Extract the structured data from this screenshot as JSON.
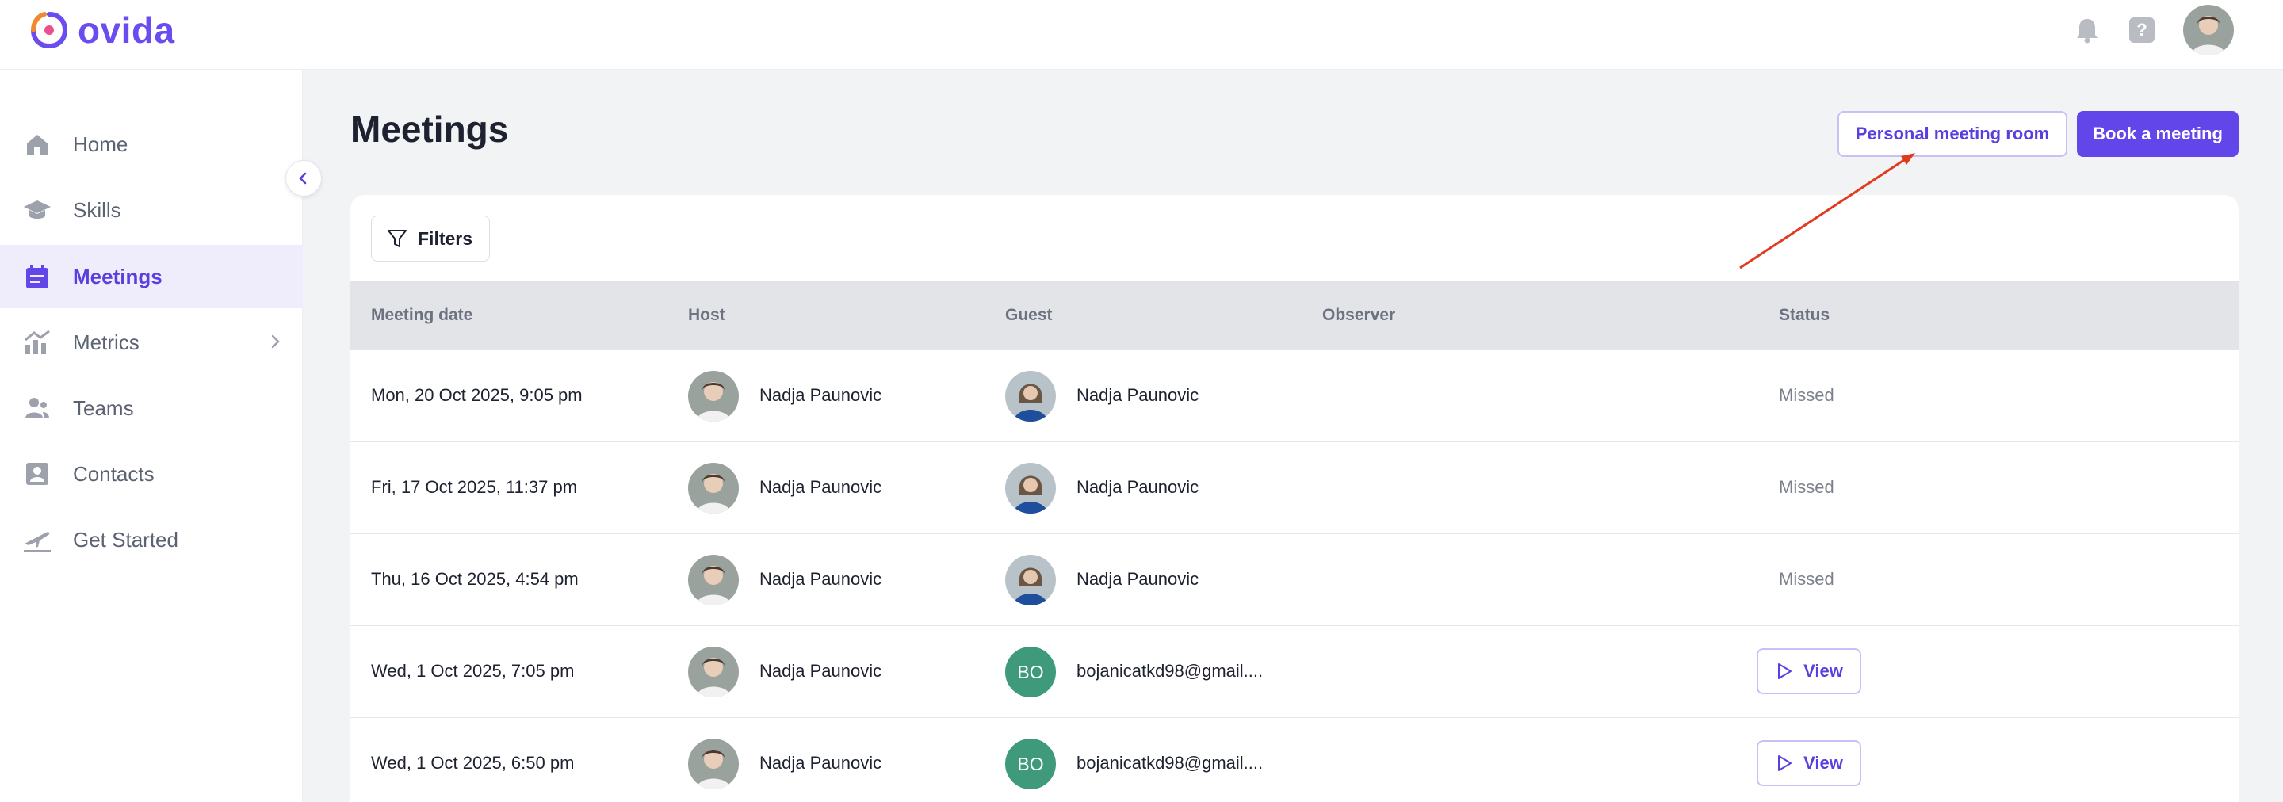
{
  "app": {
    "name": "ovida"
  },
  "colors": {
    "brand": "#6246ea",
    "active_bg": "#efedfb",
    "initials_bg": "#3e9a7a",
    "annotation_arrow": "#e23a1f"
  },
  "topbar": {
    "icons": [
      "bell-icon",
      "help-icon",
      "user-avatar"
    ],
    "help_label": "?"
  },
  "sidebar": {
    "items": [
      {
        "label": "Home",
        "icon": "home-icon",
        "active": false
      },
      {
        "label": "Skills",
        "icon": "graduation-cap-icon",
        "active": false
      },
      {
        "label": "Meetings",
        "icon": "calendar-icon",
        "active": true
      },
      {
        "label": "Metrics",
        "icon": "chart-icon",
        "active": false,
        "has_submenu": true
      },
      {
        "label": "Teams",
        "icon": "people-icon",
        "active": false
      },
      {
        "label": "Contacts",
        "icon": "contact-card-icon",
        "active": false
      },
      {
        "label": "Get Started",
        "icon": "plane-icon",
        "active": false
      }
    ]
  },
  "main": {
    "title": "Meetings",
    "personal_room_label": "Personal meeting room",
    "book_label": "Book a meeting",
    "filters_label": "Filters",
    "columns": [
      "Meeting date",
      "Host",
      "Guest",
      "Observer",
      "Status"
    ],
    "rows": [
      {
        "date": "Mon, 20 Oct 2025, 9:05 pm",
        "host": "Nadja Paunovic",
        "guest": "Nadja Paunovic",
        "guest_initials": "",
        "observer": "",
        "status": "Missed"
      },
      {
        "date": "Fri, 17 Oct 2025, 11:37 pm",
        "host": "Nadja Paunovic",
        "guest": "Nadja Paunovic",
        "guest_initials": "",
        "observer": "",
        "status": "Missed"
      },
      {
        "date": "Thu, 16 Oct 2025, 4:54 pm",
        "host": "Nadja Paunovic",
        "guest": "Nadja Paunovic",
        "guest_initials": "",
        "observer": "",
        "status": "Missed"
      },
      {
        "date": "Wed, 1 Oct 2025, 7:05 pm",
        "host": "Nadja Paunovic",
        "guest": "bojanicatkd98@gmail....",
        "guest_initials": "BO",
        "observer": "",
        "status": "View"
      },
      {
        "date": "Wed, 1 Oct 2025, 6:50 pm",
        "host": "Nadja Paunovic",
        "guest": "bojanicatkd98@gmail....",
        "guest_initials": "BO",
        "observer": "",
        "status": "View"
      }
    ]
  }
}
